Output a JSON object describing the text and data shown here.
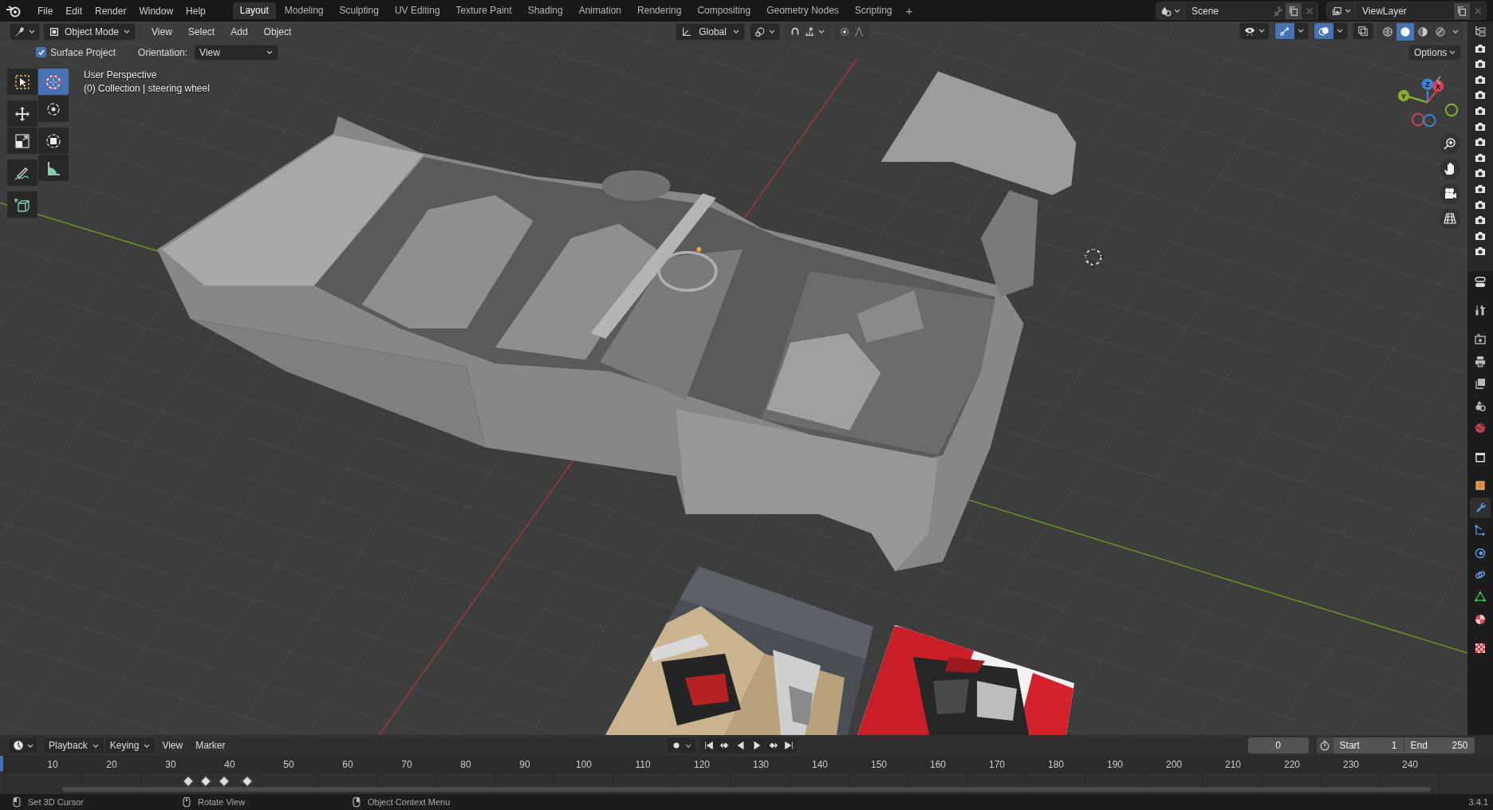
{
  "top_bar": {
    "menus": [
      "File",
      "Edit",
      "Render",
      "Window",
      "Help"
    ],
    "workspaces": [
      {
        "label": "Layout",
        "selected": true
      },
      {
        "label": "Modeling",
        "selected": false
      },
      {
        "label": "Sculpting",
        "selected": false
      },
      {
        "label": "UV Editing",
        "selected": false
      },
      {
        "label": "Texture Paint",
        "selected": false
      },
      {
        "label": "Shading",
        "selected": false
      },
      {
        "label": "Animation",
        "selected": false
      },
      {
        "label": "Rendering",
        "selected": false
      },
      {
        "label": "Compositing",
        "selected": false
      },
      {
        "label": "Geometry Nodes",
        "selected": false
      },
      {
        "label": "Scripting",
        "selected": false
      }
    ],
    "add_workspace": "+",
    "scene": "Scene",
    "view_layer": "ViewLayer"
  },
  "viewport_header": {
    "mode": "Object Mode",
    "menus": [
      "View",
      "Select",
      "Add",
      "Object"
    ],
    "orientation": "Global",
    "shading": [
      {
        "kind": "wireframe",
        "selected": false
      },
      {
        "kind": "solid",
        "selected": true
      },
      {
        "kind": "material",
        "selected": false
      },
      {
        "kind": "rendered",
        "selected": false
      }
    ]
  },
  "tool_settings": {
    "surface_project": {
      "label": "Surface Project",
      "checked": true
    },
    "orientation_label": "Orientation:",
    "orientation": "View",
    "options": "Options"
  },
  "tools": [
    {
      "kind": "select",
      "selected": false
    },
    {
      "kind": "cursor",
      "selected": true
    },
    {
      "kind": "move",
      "selected": false
    },
    {
      "kind": "rotate",
      "selected": false
    },
    {
      "kind": "scale",
      "selected": false
    },
    {
      "kind": "transform",
      "selected": false
    },
    {
      "kind": "annotate",
      "selected": false
    },
    {
      "kind": "measure",
      "selected": false
    },
    {
      "kind": "add-cube",
      "selected": false
    }
  ],
  "viewport_info": {
    "view": "User Perspective",
    "object": "(0) Collection | steering wheel"
  },
  "axes": [
    {
      "label": "X",
      "color": "#d9415a"
    },
    {
      "label": "Y",
      "color": "#86b32b"
    },
    {
      "label": "Z",
      "color": "#3d85d8"
    }
  ],
  "properties_tabs": [
    {
      "kind": "tool",
      "selected": false
    },
    {
      "kind": "render",
      "selected": false
    },
    {
      "kind": "output",
      "selected": false
    },
    {
      "kind": "view-layer",
      "selected": false
    },
    {
      "kind": "scene",
      "selected": false
    },
    {
      "kind": "world",
      "selected": false
    },
    {
      "kind": "collection",
      "selected": false
    },
    {
      "kind": "object",
      "selected": false
    },
    {
      "kind": "modifier",
      "selected": true
    },
    {
      "kind": "particles",
      "selected": false
    },
    {
      "kind": "physics",
      "selected": false
    },
    {
      "kind": "constraints",
      "selected": false
    },
    {
      "kind": "data",
      "selected": false
    },
    {
      "kind": "material",
      "selected": false
    },
    {
      "kind": "texture",
      "selected": false
    }
  ],
  "timeline": {
    "menus": [
      {
        "label": "Playback",
        "kind": "dropdown"
      },
      {
        "label": "Keying",
        "kind": "dropdown"
      },
      {
        "label": "View",
        "kind": "menu"
      },
      {
        "label": "Marker",
        "kind": "menu"
      }
    ],
    "current_frame": "0",
    "start_label": "Start",
    "start": "1",
    "end_label": "End",
    "end": "250",
    "ticks": [
      "10",
      "20",
      "30",
      "40",
      "50",
      "60",
      "70",
      "80",
      "90",
      "100",
      "110",
      "120",
      "130",
      "140",
      "150",
      "160",
      "170",
      "180",
      "190",
      "200",
      "210",
      "220",
      "230",
      "240"
    ]
  },
  "status_bar": {
    "hints": [
      {
        "kind": "left",
        "label": "Set 3D Cursor"
      },
      {
        "kind": "middle",
        "label": "Rotate View"
      },
      {
        "kind": "right",
        "label": "Object Context Menu"
      }
    ],
    "version": "3.4.1"
  }
}
